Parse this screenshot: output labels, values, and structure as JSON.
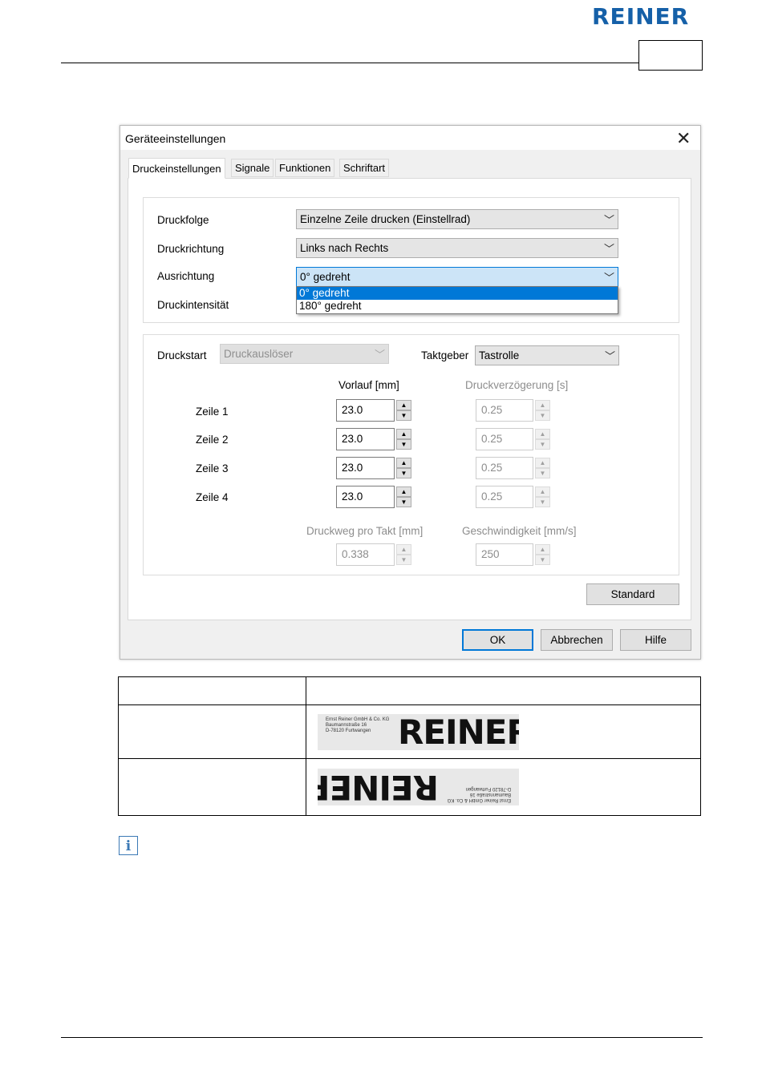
{
  "header": {
    "logo_text": "REINER",
    "brand_color": "#1560a8"
  },
  "dialog": {
    "title": "Geräteeinstellungen",
    "close_glyph": "✕",
    "tabs": [
      "Druckeinstellungen",
      "Signale",
      "Funktionen",
      "Schriftart"
    ],
    "active_tab": "Druckeinstellungen",
    "group1": {
      "druckfolge": {
        "label": "Druckfolge",
        "value": "Einzelne Zeile drucken (Einstellrad)"
      },
      "druckrichtung": {
        "label": "Druckrichtung",
        "value": "Links nach Rechts"
      },
      "ausrichtung": {
        "label": "Ausrichtung",
        "value": "0° gedreht",
        "options": [
          "0° gedreht",
          "180° gedreht"
        ],
        "selected_option": "0° gedreht"
      },
      "druckintensitaet": {
        "label": "Druckintensität"
      }
    },
    "group2": {
      "druckstart": {
        "label": "Druckstart",
        "value": "Druckauslöser",
        "disabled": true
      },
      "taktgeber": {
        "label": "Taktgeber",
        "value": "Tastrolle"
      },
      "vorlauf_header": "Vorlauf [mm]",
      "verzoegerung_header": "Druckverzögerung [s]",
      "rows": [
        {
          "label": "Zeile 1",
          "vorlauf": "23.0",
          "verzoegerung": "0.25"
        },
        {
          "label": "Zeile 2",
          "vorlauf": "23.0",
          "verzoegerung": "0.25"
        },
        {
          "label": "Zeile 3",
          "vorlauf": "23.0",
          "verzoegerung": "0.25"
        },
        {
          "label": "Zeile 4",
          "vorlauf": "23.0",
          "verzoegerung": "0.25"
        }
      ],
      "druckweg_label": "Druckweg pro Takt [mm]",
      "druckweg_value": "0.338",
      "geschwindigkeit_label": "Geschwindigkeit [mm/s]",
      "geschwindigkeit_value": "250"
    },
    "standard_button": "Standard",
    "ok_button": "OK",
    "cancel_button": "Abbrechen",
    "help_button": "Hilfe"
  },
  "samples": {
    "stamp_word": "REINER",
    "stamp_address": [
      "Ernst Reiner GmbH & Co. KG",
      "Baumannstraße 16",
      "D-78120 Furtwangen"
    ]
  },
  "note_icon": "info-icon"
}
